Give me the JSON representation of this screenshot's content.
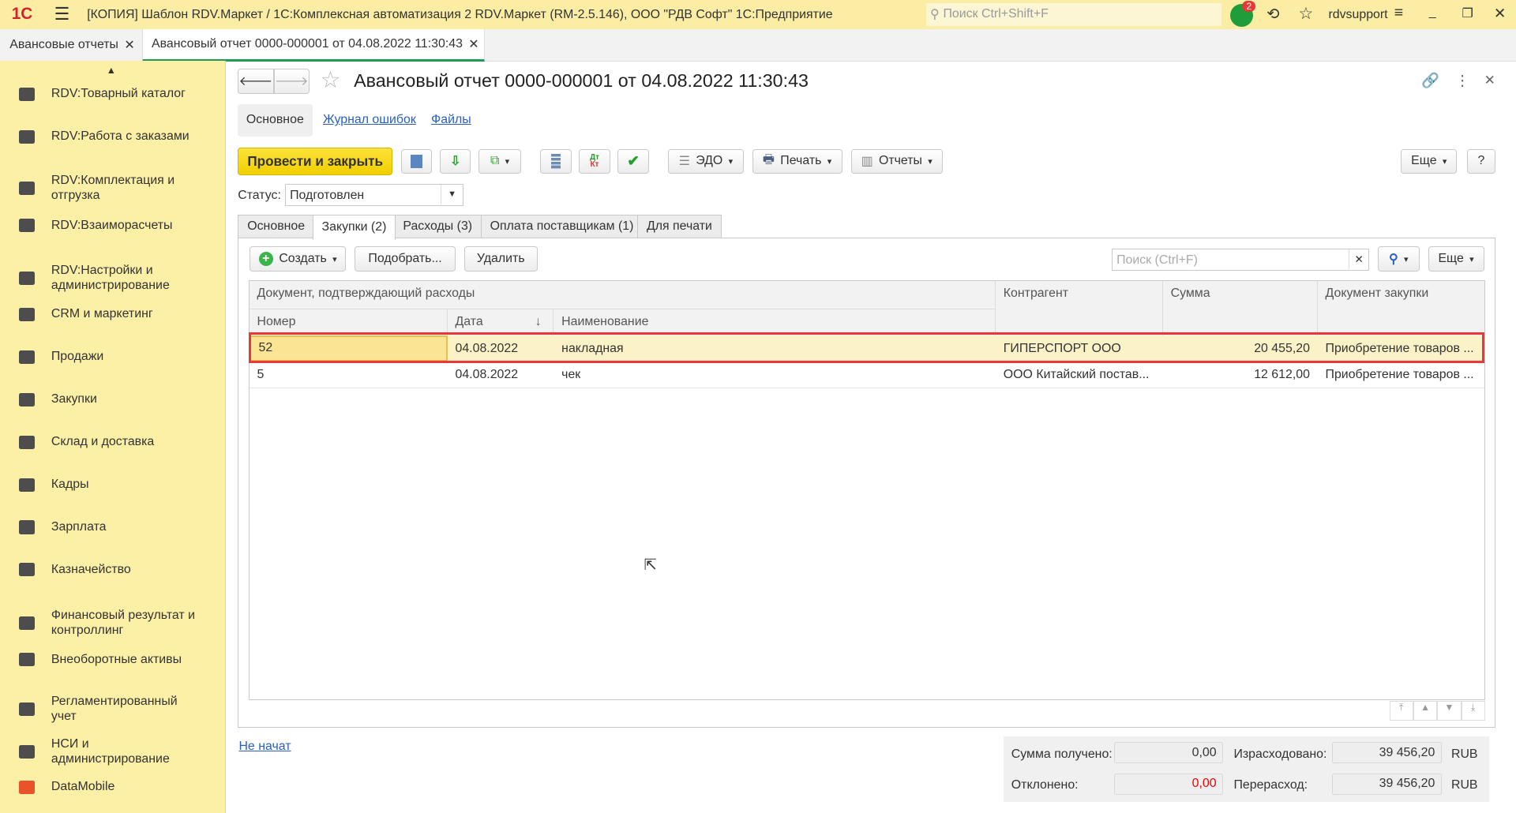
{
  "window": {
    "title": "[КОПИЯ] Шаблон RDV.Маркет / 1С:Комплексная автоматизация 2 RDV.Маркет (RM-2.5.146), ООО \"РДВ Софт\" 1С:Предприятие",
    "search_placeholder": "Поиск Ctrl+Shift+F",
    "notifications": "2",
    "user": "rdvsupport",
    "logo": "1С"
  },
  "open_tabs": [
    {
      "label": "Авансовые отчеты"
    },
    {
      "label": "Авансовый отчет 0000-000001 от 04.08.2022 11:30:43"
    }
  ],
  "sidebar": {
    "items": [
      {
        "label": "RDV:Товарный каталог"
      },
      {
        "label": "RDV:Работа с заказами"
      },
      {
        "label": "RDV:Комплектация и отгрузка"
      },
      {
        "label": "RDV:Взаиморасчеты"
      },
      {
        "label": "RDV:Настройки и администрирование"
      },
      {
        "label": "CRM и маркетинг"
      },
      {
        "label": "Продажи"
      },
      {
        "label": "Закупки"
      },
      {
        "label": "Склад и доставка"
      },
      {
        "label": "Кадры"
      },
      {
        "label": "Зарплата"
      },
      {
        "label": "Казначейство"
      },
      {
        "label": "Финансовый результат и контроллинг"
      },
      {
        "label": "Внеоборотные активы"
      },
      {
        "label": "Регламентированный учет"
      },
      {
        "label": "НСИ и администрирование"
      },
      {
        "label": "DataMobile"
      }
    ]
  },
  "form": {
    "title": "Авансовый отчет 0000-000001 от 04.08.2022 11:30:43",
    "nav_links": [
      "Основное",
      "Журнал ошибок",
      "Файлы"
    ],
    "toolbar": {
      "post_close": "Провести и закрыть",
      "edo": "ЭДО",
      "print": "Печать",
      "reports": "Отчеты",
      "more": "Еще",
      "help": "?",
      "dtkt_top": "Дт",
      "dtkt_bottom": "Кт"
    },
    "status_label": "Статус:",
    "status_value": "Подготовлен",
    "tabs": [
      "Основное",
      "Закупки (2)",
      "Расходы (3)",
      "Оплата поставщикам (1)",
      "Для печати"
    ],
    "table_toolbar": {
      "create": "Создать",
      "pick": "Подобрать...",
      "delete": "Удалить",
      "search_placeholder": "Поиск (Ctrl+F)",
      "more": "Еще"
    },
    "table": {
      "group_header": "Документ, подтверждающий расходы",
      "columns": [
        "Номер",
        "Дата",
        "Наименование",
        "Контрагент",
        "Сумма",
        "Документ закупки"
      ],
      "rows": [
        [
          "52",
          "04.08.2022",
          "накладная",
          "ГИПЕРСПОРТ ООО",
          "20 455,20",
          "Приобретение товаров ..."
        ],
        [
          "5",
          "04.08.2022",
          "чек",
          "ООО Китайский постав...",
          "12 612,00",
          "Приобретение товаров ..."
        ]
      ]
    },
    "footer": {
      "state_link": "Не начат",
      "received_label": "Сумма получено:",
      "received": "0,00",
      "spent_label": "Израсходовано:",
      "spent": "39 456,20",
      "rejected_label": "Отклонено:",
      "rejected": "0,00",
      "overspend_label": "Перерасход:",
      "overspend": "39 456,20",
      "currency": "RUB"
    }
  }
}
